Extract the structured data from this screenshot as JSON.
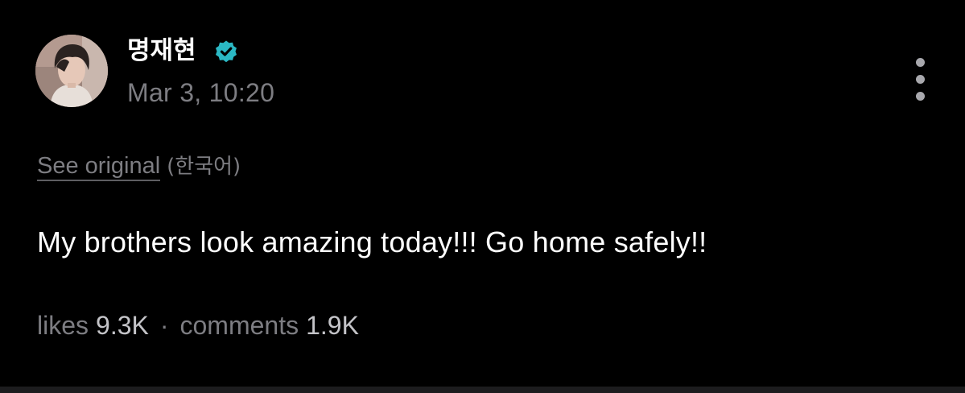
{
  "post": {
    "author": {
      "name": "명재현",
      "verified": true,
      "verified_icon": "verified-badge-icon",
      "verified_color": "#2bb8c4"
    },
    "timestamp": "Mar 3, 10:20",
    "menu_icon": "more-vertical-icon",
    "translation": {
      "see_original_label": "See original",
      "language": "(한국어)"
    },
    "text": "My brothers look amazing today!!! Go home safely!!",
    "stats": {
      "likes_label": "likes",
      "likes_value": "9.3K",
      "separator": "·",
      "comments_label": "comments",
      "comments_value": "1.9K"
    }
  },
  "colors": {
    "background": "#000000",
    "primary_text": "#ffffff",
    "secondary_text": "#7d7d82",
    "stat_value": "#c4c4c8"
  }
}
